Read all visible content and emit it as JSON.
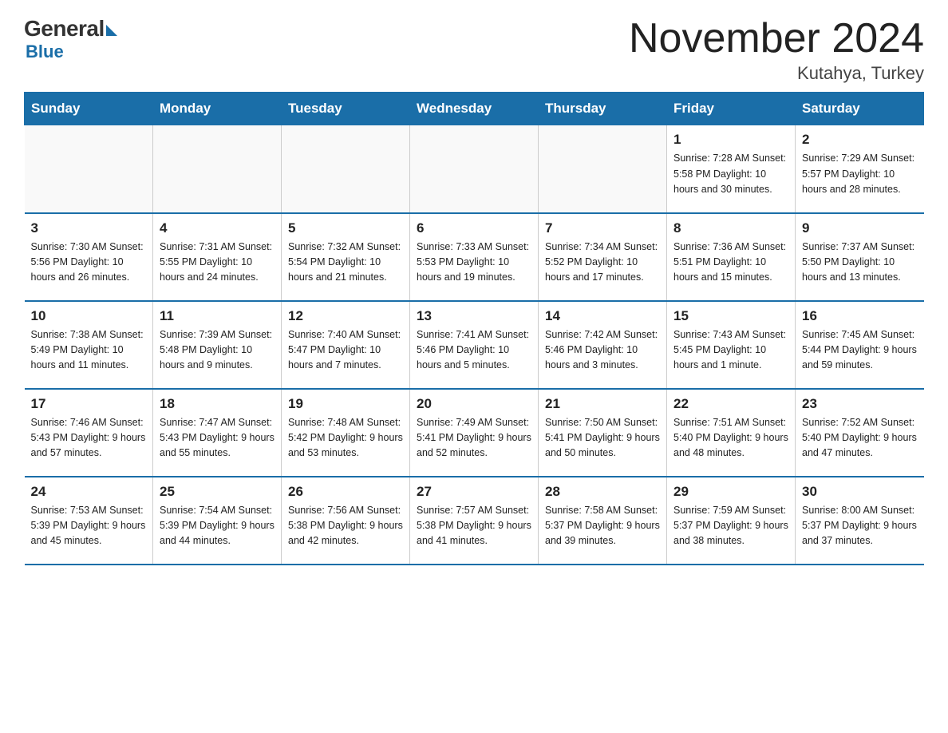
{
  "header": {
    "logo_general": "General",
    "logo_blue": "Blue",
    "month_title": "November 2024",
    "location": "Kutahya, Turkey"
  },
  "days_of_week": [
    "Sunday",
    "Monday",
    "Tuesday",
    "Wednesday",
    "Thursday",
    "Friday",
    "Saturday"
  ],
  "weeks": [
    [
      {
        "day": "",
        "info": ""
      },
      {
        "day": "",
        "info": ""
      },
      {
        "day": "",
        "info": ""
      },
      {
        "day": "",
        "info": ""
      },
      {
        "day": "",
        "info": ""
      },
      {
        "day": "1",
        "info": "Sunrise: 7:28 AM\nSunset: 5:58 PM\nDaylight: 10 hours and 30 minutes."
      },
      {
        "day": "2",
        "info": "Sunrise: 7:29 AM\nSunset: 5:57 PM\nDaylight: 10 hours and 28 minutes."
      }
    ],
    [
      {
        "day": "3",
        "info": "Sunrise: 7:30 AM\nSunset: 5:56 PM\nDaylight: 10 hours and 26 minutes."
      },
      {
        "day": "4",
        "info": "Sunrise: 7:31 AM\nSunset: 5:55 PM\nDaylight: 10 hours and 24 minutes."
      },
      {
        "day": "5",
        "info": "Sunrise: 7:32 AM\nSunset: 5:54 PM\nDaylight: 10 hours and 21 minutes."
      },
      {
        "day": "6",
        "info": "Sunrise: 7:33 AM\nSunset: 5:53 PM\nDaylight: 10 hours and 19 minutes."
      },
      {
        "day": "7",
        "info": "Sunrise: 7:34 AM\nSunset: 5:52 PM\nDaylight: 10 hours and 17 minutes."
      },
      {
        "day": "8",
        "info": "Sunrise: 7:36 AM\nSunset: 5:51 PM\nDaylight: 10 hours and 15 minutes."
      },
      {
        "day": "9",
        "info": "Sunrise: 7:37 AM\nSunset: 5:50 PM\nDaylight: 10 hours and 13 minutes."
      }
    ],
    [
      {
        "day": "10",
        "info": "Sunrise: 7:38 AM\nSunset: 5:49 PM\nDaylight: 10 hours and 11 minutes."
      },
      {
        "day": "11",
        "info": "Sunrise: 7:39 AM\nSunset: 5:48 PM\nDaylight: 10 hours and 9 minutes."
      },
      {
        "day": "12",
        "info": "Sunrise: 7:40 AM\nSunset: 5:47 PM\nDaylight: 10 hours and 7 minutes."
      },
      {
        "day": "13",
        "info": "Sunrise: 7:41 AM\nSunset: 5:46 PM\nDaylight: 10 hours and 5 minutes."
      },
      {
        "day": "14",
        "info": "Sunrise: 7:42 AM\nSunset: 5:46 PM\nDaylight: 10 hours and 3 minutes."
      },
      {
        "day": "15",
        "info": "Sunrise: 7:43 AM\nSunset: 5:45 PM\nDaylight: 10 hours and 1 minute."
      },
      {
        "day": "16",
        "info": "Sunrise: 7:45 AM\nSunset: 5:44 PM\nDaylight: 9 hours and 59 minutes."
      }
    ],
    [
      {
        "day": "17",
        "info": "Sunrise: 7:46 AM\nSunset: 5:43 PM\nDaylight: 9 hours and 57 minutes."
      },
      {
        "day": "18",
        "info": "Sunrise: 7:47 AM\nSunset: 5:43 PM\nDaylight: 9 hours and 55 minutes."
      },
      {
        "day": "19",
        "info": "Sunrise: 7:48 AM\nSunset: 5:42 PM\nDaylight: 9 hours and 53 minutes."
      },
      {
        "day": "20",
        "info": "Sunrise: 7:49 AM\nSunset: 5:41 PM\nDaylight: 9 hours and 52 minutes."
      },
      {
        "day": "21",
        "info": "Sunrise: 7:50 AM\nSunset: 5:41 PM\nDaylight: 9 hours and 50 minutes."
      },
      {
        "day": "22",
        "info": "Sunrise: 7:51 AM\nSunset: 5:40 PM\nDaylight: 9 hours and 48 minutes."
      },
      {
        "day": "23",
        "info": "Sunrise: 7:52 AM\nSunset: 5:40 PM\nDaylight: 9 hours and 47 minutes."
      }
    ],
    [
      {
        "day": "24",
        "info": "Sunrise: 7:53 AM\nSunset: 5:39 PM\nDaylight: 9 hours and 45 minutes."
      },
      {
        "day": "25",
        "info": "Sunrise: 7:54 AM\nSunset: 5:39 PM\nDaylight: 9 hours and 44 minutes."
      },
      {
        "day": "26",
        "info": "Sunrise: 7:56 AM\nSunset: 5:38 PM\nDaylight: 9 hours and 42 minutes."
      },
      {
        "day": "27",
        "info": "Sunrise: 7:57 AM\nSunset: 5:38 PM\nDaylight: 9 hours and 41 minutes."
      },
      {
        "day": "28",
        "info": "Sunrise: 7:58 AM\nSunset: 5:37 PM\nDaylight: 9 hours and 39 minutes."
      },
      {
        "day": "29",
        "info": "Sunrise: 7:59 AM\nSunset: 5:37 PM\nDaylight: 9 hours and 38 minutes."
      },
      {
        "day": "30",
        "info": "Sunrise: 8:00 AM\nSunset: 5:37 PM\nDaylight: 9 hours and 37 minutes."
      }
    ]
  ]
}
